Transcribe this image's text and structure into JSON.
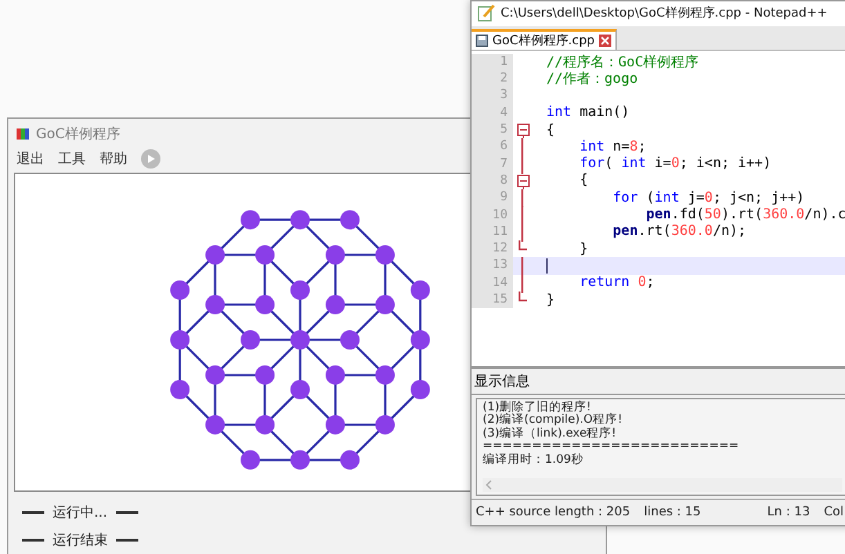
{
  "goc_window": {
    "title": "GoC样例程序",
    "menu": [
      "退出",
      "工具",
      "帮助"
    ],
    "status_lines": [
      "运行中...",
      "运行结束"
    ]
  },
  "notepad_window": {
    "title": "C:\\Users\\dell\\Desktop\\GoC样例程序.cpp - Notepad++",
    "tabs": [
      {
        "label": "GoC样例程序.cpp",
        "selected": true
      }
    ],
    "code_lines": [
      {
        "number": "1",
        "kind": "plain",
        "current": false,
        "tokens": [
          {
            "kind": "comment",
            "text": "//程序名：GoC样例程序"
          }
        ]
      },
      {
        "number": "2",
        "kind": "plain",
        "current": false,
        "tokens": [
          {
            "kind": "comment",
            "text": "//作者：gogo"
          }
        ]
      },
      {
        "number": "3",
        "kind": "plain",
        "current": false
      },
      {
        "number": "4",
        "kind": "plain",
        "current": false,
        "tokens": [
          {
            "kind": "keyword",
            "text": "int"
          },
          {
            "kind": "plain",
            "text": " main()"
          }
        ]
      },
      {
        "number": "5",
        "kind": "start",
        "current": false,
        "tokens": [
          {
            "kind": "plain",
            "text": "{"
          }
        ]
      },
      {
        "number": "6",
        "kind": "body",
        "current": false,
        "tokens": [
          {
            "kind": "keyword",
            "text": "    int"
          },
          {
            "kind": "plain",
            "text": " n="
          },
          {
            "kind": "number",
            "text": "8"
          },
          {
            "kind": "plain",
            "text": ";"
          }
        ]
      },
      {
        "number": "7",
        "kind": "body",
        "current": false,
        "tokens": [
          {
            "kind": "keyword",
            "text": "    for"
          },
          {
            "kind": "plain",
            "text": "( "
          },
          {
            "kind": "keyword",
            "text": "int"
          },
          {
            "kind": "plain",
            "text": " i="
          },
          {
            "kind": "number",
            "text": "0"
          },
          {
            "kind": "plain",
            "text": "; i<n; i++)"
          }
        ]
      },
      {
        "number": "8",
        "kind": "start",
        "current": false,
        "tokens": [
          {
            "kind": "plain",
            "text": "    {"
          }
        ]
      },
      {
        "number": "9",
        "kind": "body",
        "current": false,
        "tokens": [
          {
            "kind": "keyword",
            "text": "        for"
          },
          {
            "kind": "plain",
            "text": " ("
          },
          {
            "kind": "keyword",
            "text": "int"
          },
          {
            "kind": "plain",
            "text": " j="
          },
          {
            "kind": "number",
            "text": "0"
          },
          {
            "kind": "plain",
            "text": "; j<n; j++)"
          }
        ]
      },
      {
        "number": "10",
        "kind": "body",
        "current": false,
        "tokens": [
          {
            "kind": "object",
            "text": "            pen"
          },
          {
            "kind": "plain",
            "text": ".fd("
          },
          {
            "kind": "number",
            "text": "50"
          },
          {
            "kind": "plain",
            "text": ").rt("
          },
          {
            "kind": "number",
            "text": "360.0"
          },
          {
            "kind": "plain",
            "text": "/n).c"
          }
        ]
      },
      {
        "number": "11",
        "kind": "body",
        "current": false,
        "tokens": [
          {
            "kind": "object",
            "text": "        pen"
          },
          {
            "kind": "plain",
            "text": ".rt("
          },
          {
            "kind": "number",
            "text": "360.0"
          },
          {
            "kind": "plain",
            "text": "/n);"
          }
        ]
      },
      {
        "number": "12",
        "kind": "end",
        "current": false,
        "tokens": [
          {
            "kind": "plain",
            "text": "    }"
          }
        ]
      },
      {
        "number": "13",
        "kind": "body",
        "current": true
      },
      {
        "number": "14",
        "kind": "body",
        "current": false,
        "tokens": [
          {
            "kind": "keyword",
            "text": "    return"
          },
          {
            "kind": "number",
            "text": " 0"
          },
          {
            "kind": "plain",
            "text": ";"
          }
        ]
      },
      {
        "number": "15",
        "kind": "end",
        "current": false,
        "tokens": [
          {
            "kind": "plain",
            "text": "}"
          }
        ]
      }
    ],
    "output_panel": {
      "title": "显示信息",
      "lines": [
        "(1)删除了旧的程序!",
        "(2)编译(compile).O程序!",
        "(3)编译（link).exe程序!",
        "==========================",
        "编译用时：1.09秒"
      ]
    },
    "status_bar": [
      "C++ source length : 205",
      "lines : 15",
      "Ln : 13",
      "Col"
    ]
  }
}
